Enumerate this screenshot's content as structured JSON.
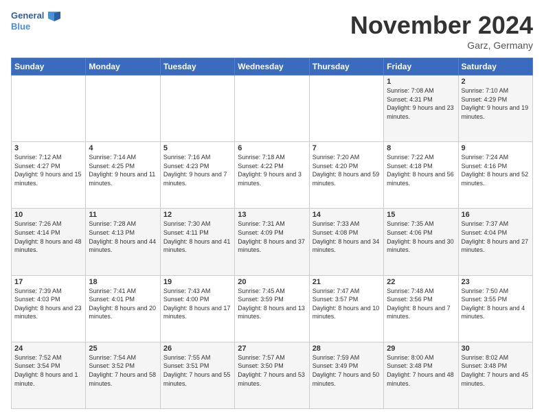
{
  "header": {
    "logo_general": "General",
    "logo_blue": "Blue",
    "month_title": "November 2024",
    "location": "Garz, Germany"
  },
  "weekdays": [
    "Sunday",
    "Monday",
    "Tuesday",
    "Wednesday",
    "Thursday",
    "Friday",
    "Saturday"
  ],
  "weeks": [
    [
      {
        "day": "",
        "info": ""
      },
      {
        "day": "",
        "info": ""
      },
      {
        "day": "",
        "info": ""
      },
      {
        "day": "",
        "info": ""
      },
      {
        "day": "",
        "info": ""
      },
      {
        "day": "1",
        "info": "Sunrise: 7:08 AM\nSunset: 4:31 PM\nDaylight: 9 hours\nand 23 minutes."
      },
      {
        "day": "2",
        "info": "Sunrise: 7:10 AM\nSunset: 4:29 PM\nDaylight: 9 hours\nand 19 minutes."
      }
    ],
    [
      {
        "day": "3",
        "info": "Sunrise: 7:12 AM\nSunset: 4:27 PM\nDaylight: 9 hours\nand 15 minutes."
      },
      {
        "day": "4",
        "info": "Sunrise: 7:14 AM\nSunset: 4:25 PM\nDaylight: 9 hours\nand 11 minutes."
      },
      {
        "day": "5",
        "info": "Sunrise: 7:16 AM\nSunset: 4:23 PM\nDaylight: 9 hours\nand 7 minutes."
      },
      {
        "day": "6",
        "info": "Sunrise: 7:18 AM\nSunset: 4:22 PM\nDaylight: 9 hours\nand 3 minutes."
      },
      {
        "day": "7",
        "info": "Sunrise: 7:20 AM\nSunset: 4:20 PM\nDaylight: 8 hours\nand 59 minutes."
      },
      {
        "day": "8",
        "info": "Sunrise: 7:22 AM\nSunset: 4:18 PM\nDaylight: 8 hours\nand 56 minutes."
      },
      {
        "day": "9",
        "info": "Sunrise: 7:24 AM\nSunset: 4:16 PM\nDaylight: 8 hours\nand 52 minutes."
      }
    ],
    [
      {
        "day": "10",
        "info": "Sunrise: 7:26 AM\nSunset: 4:14 PM\nDaylight: 8 hours\nand 48 minutes."
      },
      {
        "day": "11",
        "info": "Sunrise: 7:28 AM\nSunset: 4:13 PM\nDaylight: 8 hours\nand 44 minutes."
      },
      {
        "day": "12",
        "info": "Sunrise: 7:30 AM\nSunset: 4:11 PM\nDaylight: 8 hours\nand 41 minutes."
      },
      {
        "day": "13",
        "info": "Sunrise: 7:31 AM\nSunset: 4:09 PM\nDaylight: 8 hours\nand 37 minutes."
      },
      {
        "day": "14",
        "info": "Sunrise: 7:33 AM\nSunset: 4:08 PM\nDaylight: 8 hours\nand 34 minutes."
      },
      {
        "day": "15",
        "info": "Sunrise: 7:35 AM\nSunset: 4:06 PM\nDaylight: 8 hours\nand 30 minutes."
      },
      {
        "day": "16",
        "info": "Sunrise: 7:37 AM\nSunset: 4:04 PM\nDaylight: 8 hours\nand 27 minutes."
      }
    ],
    [
      {
        "day": "17",
        "info": "Sunrise: 7:39 AM\nSunset: 4:03 PM\nDaylight: 8 hours\nand 23 minutes."
      },
      {
        "day": "18",
        "info": "Sunrise: 7:41 AM\nSunset: 4:01 PM\nDaylight: 8 hours\nand 20 minutes."
      },
      {
        "day": "19",
        "info": "Sunrise: 7:43 AM\nSunset: 4:00 PM\nDaylight: 8 hours\nand 17 minutes."
      },
      {
        "day": "20",
        "info": "Sunrise: 7:45 AM\nSunset: 3:59 PM\nDaylight: 8 hours\nand 13 minutes."
      },
      {
        "day": "21",
        "info": "Sunrise: 7:47 AM\nSunset: 3:57 PM\nDaylight: 8 hours\nand 10 minutes."
      },
      {
        "day": "22",
        "info": "Sunrise: 7:48 AM\nSunset: 3:56 PM\nDaylight: 8 hours\nand 7 minutes."
      },
      {
        "day": "23",
        "info": "Sunrise: 7:50 AM\nSunset: 3:55 PM\nDaylight: 8 hours\nand 4 minutes."
      }
    ],
    [
      {
        "day": "24",
        "info": "Sunrise: 7:52 AM\nSunset: 3:54 PM\nDaylight: 8 hours\nand 1 minute."
      },
      {
        "day": "25",
        "info": "Sunrise: 7:54 AM\nSunset: 3:52 PM\nDaylight: 7 hours\nand 58 minutes."
      },
      {
        "day": "26",
        "info": "Sunrise: 7:55 AM\nSunset: 3:51 PM\nDaylight: 7 hours\nand 55 minutes."
      },
      {
        "day": "27",
        "info": "Sunrise: 7:57 AM\nSunset: 3:50 PM\nDaylight: 7 hours\nand 53 minutes."
      },
      {
        "day": "28",
        "info": "Sunrise: 7:59 AM\nSunset: 3:49 PM\nDaylight: 7 hours\nand 50 minutes."
      },
      {
        "day": "29",
        "info": "Sunrise: 8:00 AM\nSunset: 3:48 PM\nDaylight: 7 hours\nand 48 minutes."
      },
      {
        "day": "30",
        "info": "Sunrise: 8:02 AM\nSunset: 3:48 PM\nDaylight: 7 hours\nand 45 minutes."
      }
    ]
  ]
}
